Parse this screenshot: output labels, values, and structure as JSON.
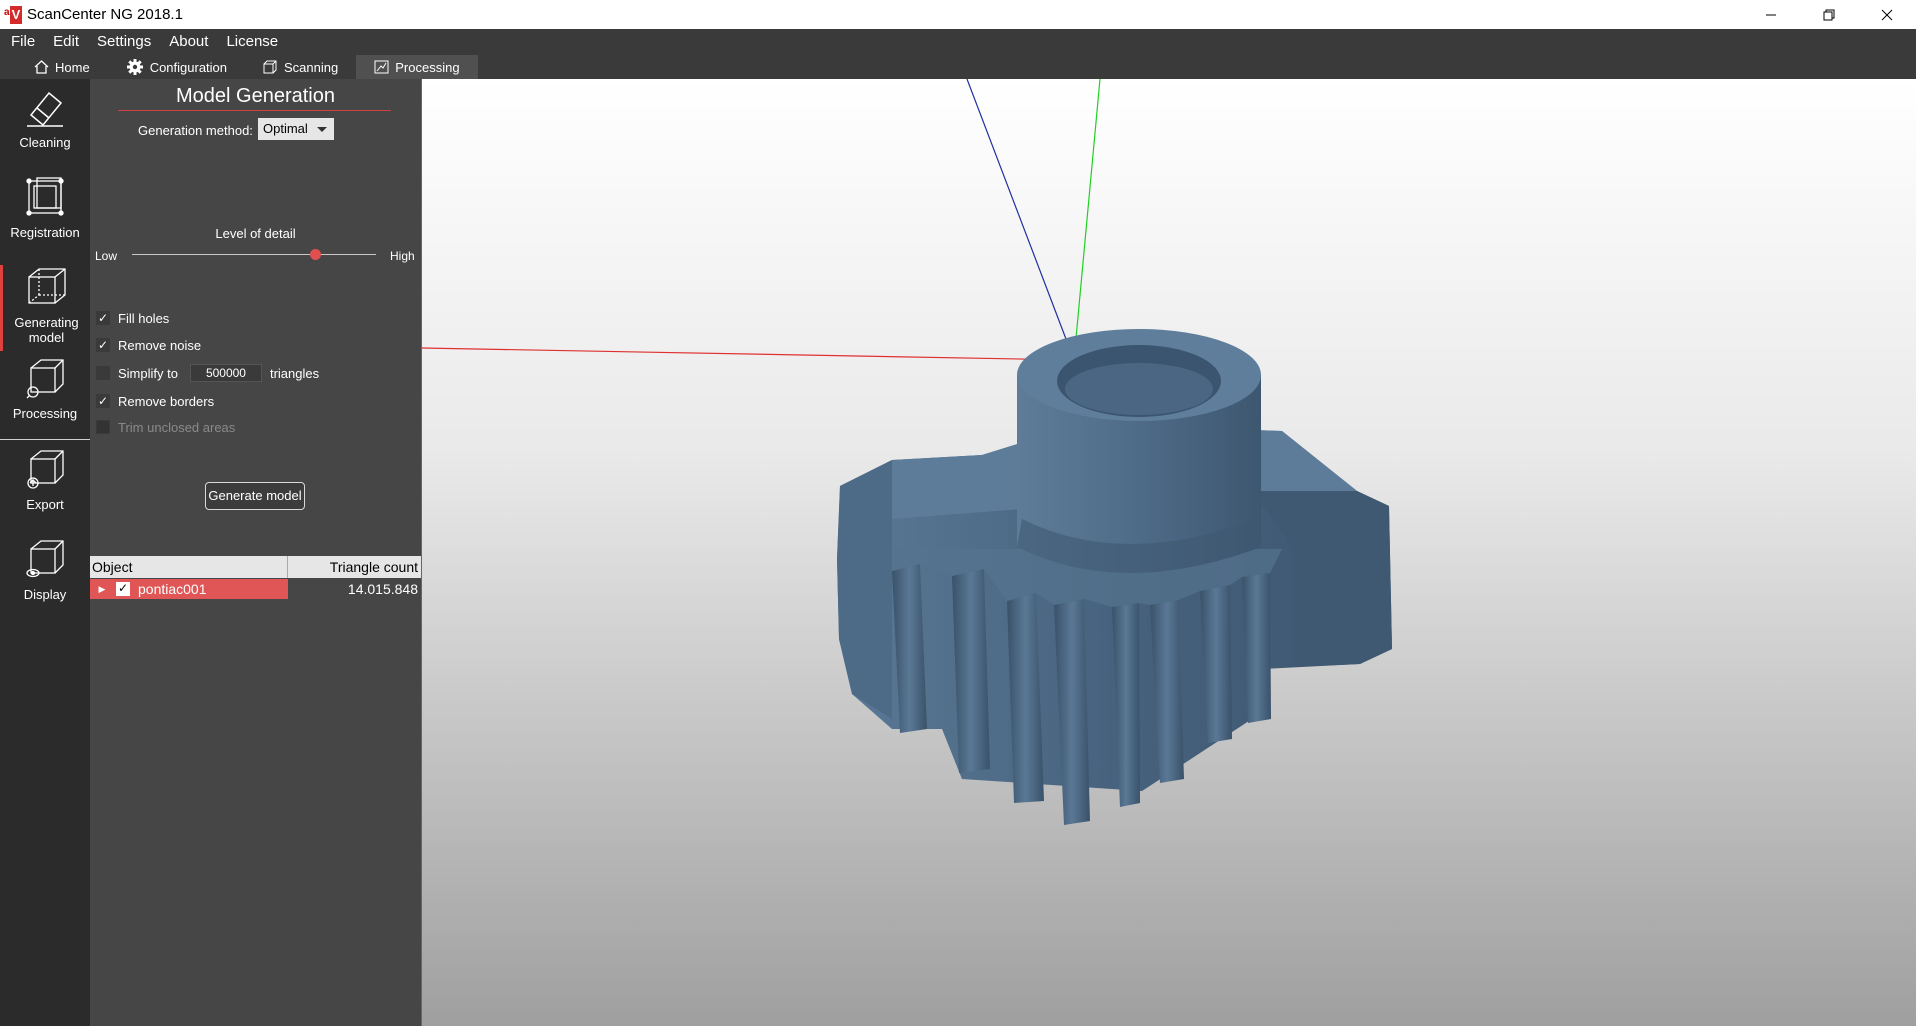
{
  "window": {
    "title": "ScanCenter NG 2018.1",
    "logo_text_a": "a",
    "logo_text_v": "V"
  },
  "menu": [
    "File",
    "Edit",
    "Settings",
    "About",
    "License"
  ],
  "tabs": [
    {
      "label": "Home",
      "icon": "home-icon"
    },
    {
      "label": "Configuration",
      "icon": "gear-icon"
    },
    {
      "label": "Scanning",
      "icon": "scan-icon"
    },
    {
      "label": "Processing",
      "icon": "processing-icon",
      "active": true
    }
  ],
  "sidebar": {
    "items": [
      {
        "label": "Cleaning",
        "icon": "eraser-icon"
      },
      {
        "label": "Registration",
        "icon": "registration-icon"
      },
      {
        "label": "Generating\nmodel",
        "label_line1": "Generating",
        "label_line2": "model",
        "icon": "cube-icon",
        "active": true
      },
      {
        "label": "Processing",
        "icon": "processing-cube-icon"
      },
      {
        "label": "Export",
        "icon": "export-cube-icon"
      },
      {
        "label": "Display",
        "icon": "display-cube-icon"
      }
    ]
  },
  "panel": {
    "title": "Model Generation",
    "generation_method_label": "Generation method:",
    "generation_method_value": "Optimal",
    "level_of_detail_label": "Level of detail",
    "lod_low": "Low",
    "lod_high": "High",
    "lod_value": 0.75,
    "options": {
      "fill_holes": {
        "label": "Fill holes",
        "checked": true
      },
      "remove_noise": {
        "label": "Remove noise",
        "checked": true
      },
      "simplify": {
        "label_before": "Simplify to",
        "value": "500000",
        "label_after": "triangles",
        "checked": false
      },
      "remove_borders": {
        "label": "Remove borders",
        "checked": true
      },
      "trim_unclosed": {
        "label": "Trim unclosed areas",
        "checked": false,
        "disabled": true
      }
    },
    "generate_button": "Generate model",
    "table": {
      "headers": [
        "Object",
        "Triangle count"
      ],
      "rows": [
        {
          "name": "pontiac001",
          "count": "14.015.848",
          "checked": true
        }
      ]
    }
  },
  "colors": {
    "accent": "#e05555",
    "axis_x": "#e03030",
    "axis_y": "#20d020",
    "axis_z": "#2030a0",
    "model": "#4a6a88"
  }
}
